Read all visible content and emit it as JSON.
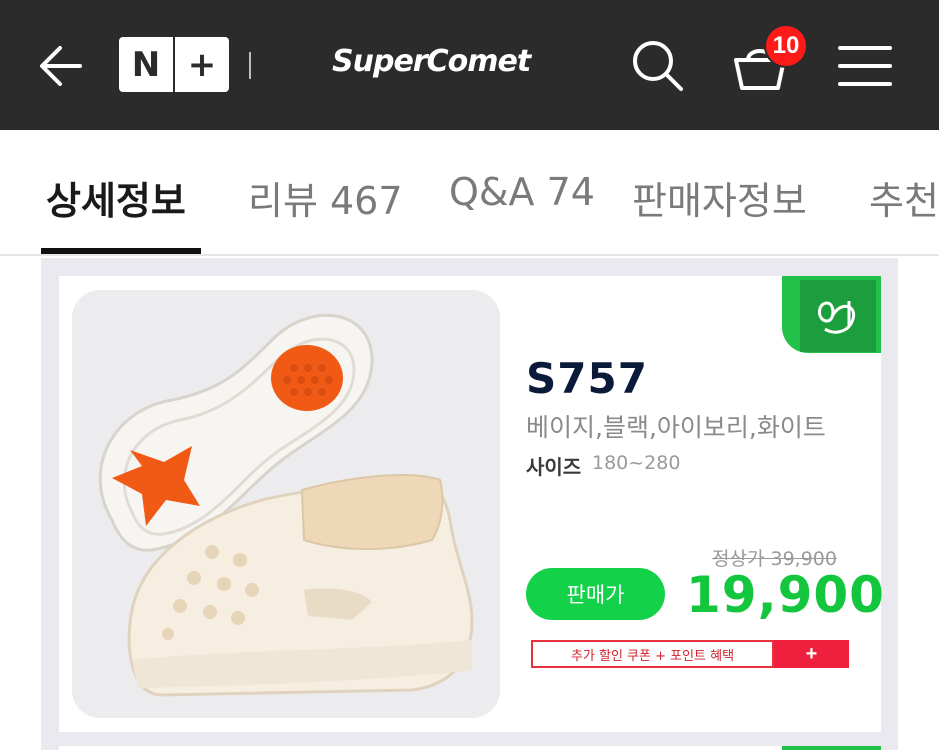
{
  "header": {
    "logo_left": "N",
    "logo_right": "+",
    "brand": "SuperComet",
    "cart_count": "10",
    "icons": [
      "back-arrow-icon",
      "search-icon",
      "cart-icon",
      "hamburger-menu-icon"
    ]
  },
  "tabs": [
    {
      "label": "상세정보",
      "active": true
    },
    {
      "label": "리뷰 467",
      "active": false
    },
    {
      "label": "Q&A 74",
      "active": false
    },
    {
      "label": "판매자정보",
      "active": false
    },
    {
      "label": "추천",
      "active": false
    }
  ],
  "product": {
    "model": "S757",
    "colors": "베이지,블랙,아이보리,화이트",
    "size_label": "사이즈",
    "size_range": "180~280",
    "original_price": "정상가 39,900",
    "sale_label": "판매가",
    "sale_price": "19,900",
    "coupon_text": "추가 할인 쿠폰 + 포인트 혜택",
    "coupon_plus": "+"
  },
  "colors": {
    "header_bg": "#2b2b2b",
    "accent_green": "#14c63e",
    "badge_red": "#ff1a1a",
    "coupon_red": "#ef1f3e"
  }
}
